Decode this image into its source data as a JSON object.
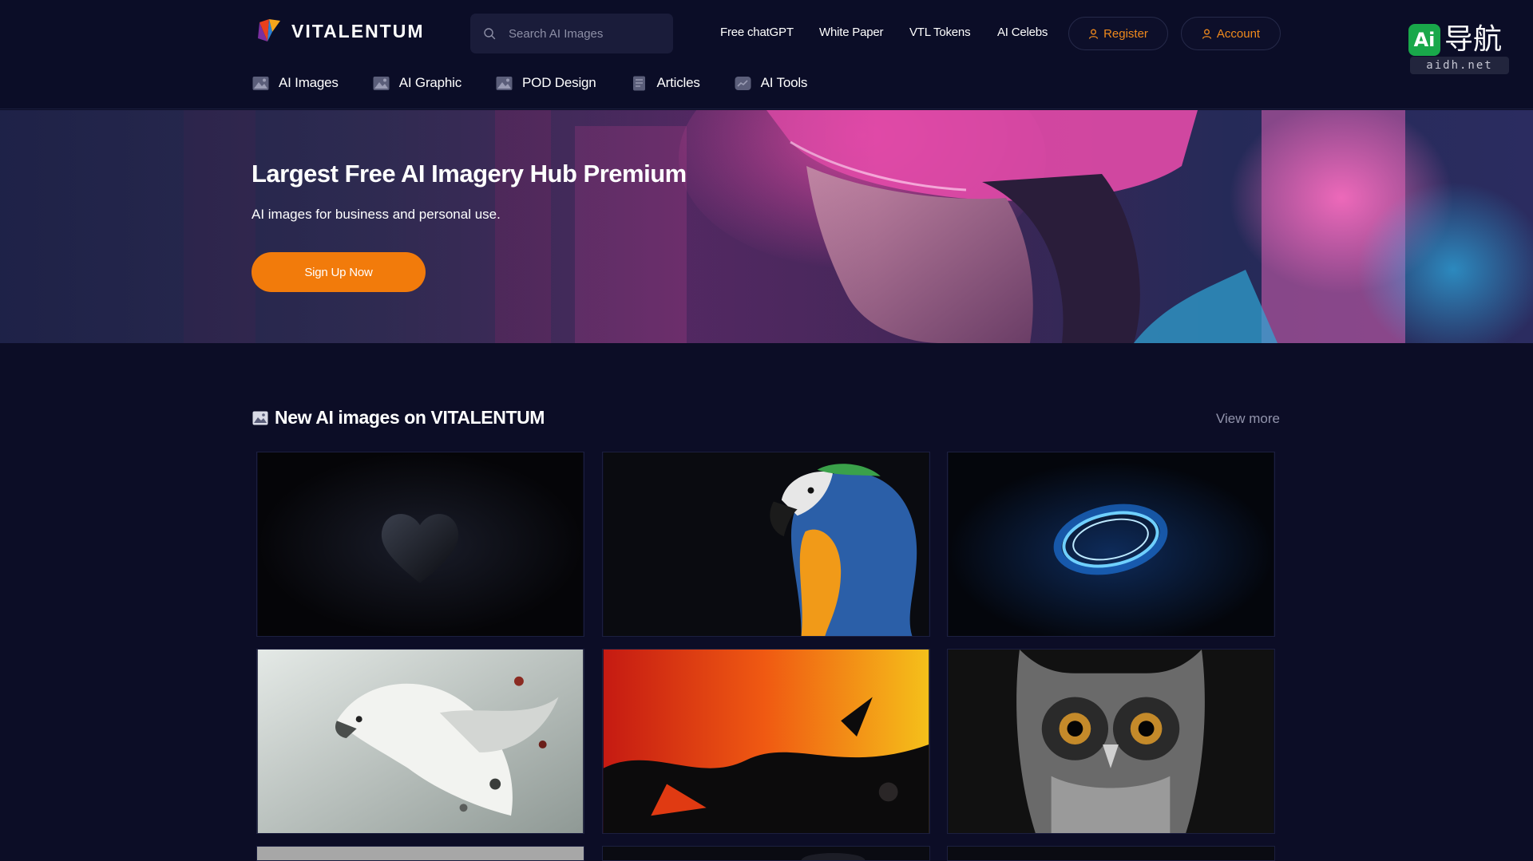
{
  "brand": {
    "name": "VITALENTUM"
  },
  "search": {
    "placeholder": "Search AI Images"
  },
  "top_links": [
    "Free chatGPT",
    "White Paper",
    "VTL Tokens",
    "AI Celebs"
  ],
  "account_actions": {
    "register": "Register",
    "account": "Account"
  },
  "badge": {
    "ai": "Ai",
    "cn": "导航",
    "domain": "aidh.net"
  },
  "nav": [
    {
      "label": "AI Images",
      "icon": "image-icon"
    },
    {
      "label": "AI Graphic",
      "icon": "image-icon"
    },
    {
      "label": "POD Design",
      "icon": "image-icon"
    },
    {
      "label": "Articles",
      "icon": "document-icon"
    },
    {
      "label": "AI Tools",
      "icon": "chart-icon"
    }
  ],
  "hero": {
    "title": "Largest Free AI Imagery Hub Premium",
    "subtitle": "AI images for business and personal use.",
    "cta": "Sign Up Now"
  },
  "gallery": {
    "title": "New AI images on VITALENTUM",
    "view_more": "View more",
    "items": [
      {
        "subject": "black heart"
      },
      {
        "subject": "macaw parrot"
      },
      {
        "subject": "blue glowing ring"
      },
      {
        "subject": "white eagle with leaves"
      },
      {
        "subject": "red and yellow paint splash"
      },
      {
        "subject": "black and white owl"
      }
    ]
  },
  "colors": {
    "accent": "#f27b0b",
    "background": "#0c0d26",
    "header": "#0b0d27",
    "muted": "#9294ac"
  }
}
